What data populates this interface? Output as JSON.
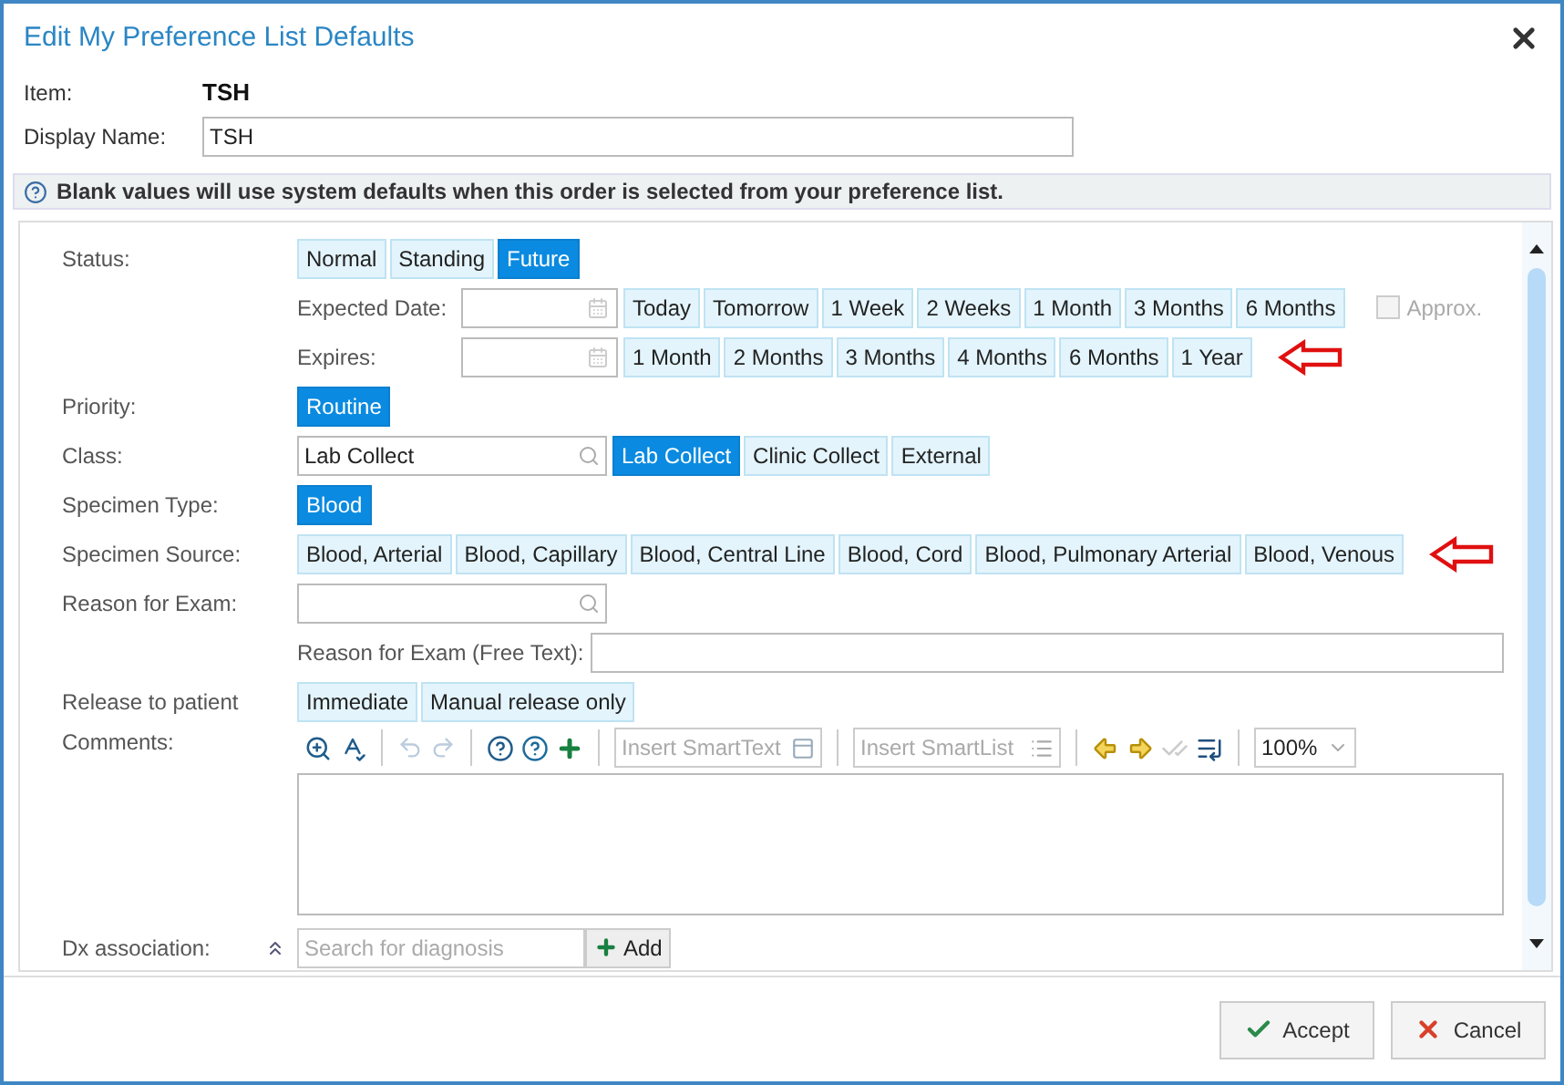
{
  "dialog": {
    "title": "Edit My Preference List Defaults"
  },
  "item": {
    "label": "Item:",
    "value": "TSH"
  },
  "display_name": {
    "label": "Display Name:",
    "value": "TSH"
  },
  "notice": "Blank values will use system defaults when this order is selected from your preference list.",
  "fields": [
    {
      "kind": "buttons",
      "label": "Status:",
      "annotated": false,
      "options": [
        {
          "label": "Normal",
          "selected": false
        },
        {
          "label": "Standing",
          "selected": false
        },
        {
          "label": "Future",
          "selected": true
        }
      ]
    },
    {
      "kind": "date",
      "label": "Expected Date:",
      "annotated": false,
      "options": [
        {
          "label": "Today",
          "selected": false
        },
        {
          "label": "Tomorrow",
          "selected": false
        },
        {
          "label": "1 Week",
          "selected": false
        },
        {
          "label": "2 Weeks",
          "selected": false
        },
        {
          "label": "1 Month",
          "selected": false
        },
        {
          "label": "3 Months",
          "selected": false
        },
        {
          "label": "6 Months",
          "selected": false
        }
      ],
      "approx": {
        "label": "Approx.",
        "checked": false
      }
    },
    {
      "kind": "date",
      "label": "Expires:",
      "annotated": true,
      "options": [
        {
          "label": "1 Month",
          "selected": false
        },
        {
          "label": "2 Months",
          "selected": false
        },
        {
          "label": "3 Months",
          "selected": false
        },
        {
          "label": "4 Months",
          "selected": false
        },
        {
          "label": "6 Months",
          "selected": false
        },
        {
          "label": "1 Year",
          "selected": false
        }
      ]
    },
    {
      "kind": "buttons",
      "label": "Priority:",
      "annotated": false,
      "options": [
        {
          "label": "Routine",
          "selected": true
        }
      ]
    },
    {
      "kind": "lookup",
      "label": "Class:",
      "value": "Lab Collect",
      "annotated": false,
      "options": [
        {
          "label": "Lab Collect",
          "selected": true
        },
        {
          "label": "Clinic Collect",
          "selected": false
        },
        {
          "label": "External",
          "selected": false
        }
      ]
    },
    {
      "kind": "buttons",
      "label": "Specimen Type:",
      "annotated": false,
      "options": [
        {
          "label": "Blood",
          "selected": true
        }
      ]
    },
    {
      "kind": "buttons",
      "label": "Specimen Source:",
      "annotated": true,
      "options": [
        {
          "label": "Blood, Arterial",
          "selected": false
        },
        {
          "label": "Blood, Capillary",
          "selected": false
        },
        {
          "label": "Blood, Central Line",
          "selected": false
        },
        {
          "label": "Blood, Cord",
          "selected": false
        },
        {
          "label": "Blood, Pulmonary Arterial",
          "selected": false
        },
        {
          "label": "Blood, Venous",
          "selected": false
        }
      ]
    },
    {
      "kind": "lookup",
      "label": "Reason for Exam:",
      "annotated": false
    },
    {
      "kind": "text",
      "label": "Reason for Exam (Free Text):",
      "annotated": false
    },
    {
      "kind": "buttons",
      "label": "Release to patient",
      "annotated": false,
      "options": [
        {
          "label": "Immediate",
          "selected": false
        },
        {
          "label": "Manual release only",
          "selected": false
        }
      ]
    },
    {
      "kind": "editor",
      "label": "Comments:",
      "annotated": false,
      "smarttext_placeholder": "Insert SmartText",
      "smartlist_placeholder": "Insert SmartList",
      "zoom": "100%"
    },
    {
      "kind": "diagnosis",
      "label": "Dx association:",
      "annotated": false,
      "placeholder": "Search for diagnosis",
      "button": "Add"
    }
  ],
  "footer_buttons": [
    {
      "kind": "accept",
      "label": "Accept"
    },
    {
      "kind": "cancel",
      "label": "Cancel"
    }
  ]
}
